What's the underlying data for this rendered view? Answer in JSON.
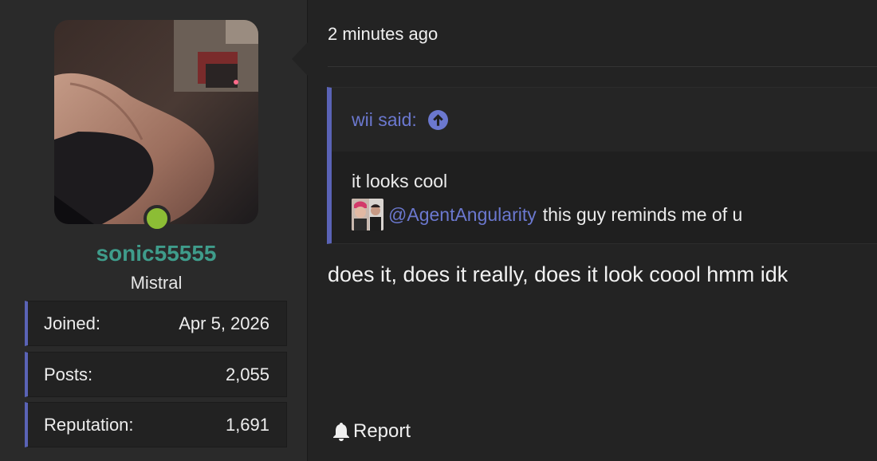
{
  "user": {
    "username": "sonic55555",
    "title": "Mistral",
    "online_status_color": "#8cbd35",
    "stats": [
      {
        "label": "Joined:",
        "value": "Apr 5, 2026"
      },
      {
        "label": "Posts:",
        "value": "2,055"
      },
      {
        "label": "Reputation:",
        "value": "1,691"
      }
    ]
  },
  "post": {
    "timestamp": "2 minutes ago",
    "quote": {
      "author_label": "wii said:",
      "line1": "it looks cool",
      "mention": "@AgentAngularity",
      "line2_rest": "this guy reminds me of u"
    },
    "message": "does it, does it really, does it look coool hmm idk",
    "actions": {
      "report_label": "Report"
    }
  },
  "colors": {
    "accent": "#5a63b6",
    "link": "#6b78cf",
    "username": "#3f9c8b",
    "background": "#232323"
  },
  "icons": [
    "up-arrow-circle-icon",
    "bell-icon",
    "online-indicator"
  ]
}
